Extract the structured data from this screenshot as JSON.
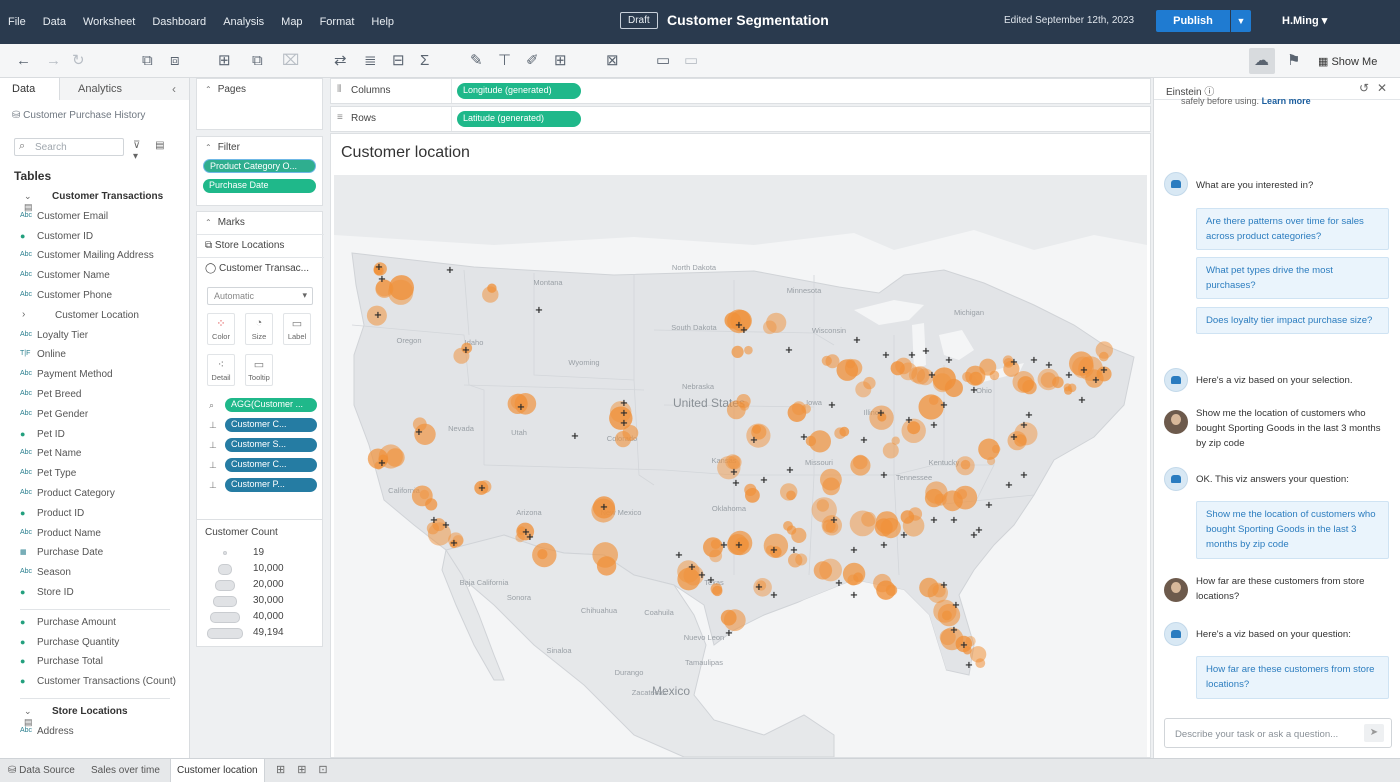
{
  "menu": [
    "File",
    "Data",
    "Worksheet",
    "Dashboard",
    "Analysis",
    "Map",
    "Format",
    "Help"
  ],
  "header": {
    "draft_label": "Draft",
    "workbook_title": "Customer Segmentation",
    "edited": "Edited September 12th, 2023",
    "publish_label": "Publish",
    "user": "H.Ming"
  },
  "toolbar": {
    "show_me": "Show Me"
  },
  "data_pane": {
    "tab_data": "Data",
    "tab_analytics": "Analytics",
    "source": "Customer Purchase History",
    "search_placeholder": "Search",
    "tables_heading": "Tables",
    "group1": "Customer Transactions",
    "fields1": [
      {
        "type": "Abc",
        "name": "Customer Email"
      },
      {
        "type": "●",
        "name": "Customer ID"
      },
      {
        "type": "Abc",
        "name": "Customer Mailing Address"
      },
      {
        "type": "Abc",
        "name": "Customer Name"
      },
      {
        "type": "Abc",
        "name": "Customer Phone"
      },
      {
        "type": "›",
        "name": "Customer Location"
      },
      {
        "type": "Abc",
        "name": "Loyalty Tier"
      },
      {
        "type": "T|F",
        "name": "Online"
      },
      {
        "type": "Abc",
        "name": "Payment Method"
      },
      {
        "type": "Abc",
        "name": "Pet Breed"
      },
      {
        "type": "Abc",
        "name": "Pet Gender"
      },
      {
        "type": "●",
        "name": "Pet ID"
      },
      {
        "type": "Abc",
        "name": "Pet Name"
      },
      {
        "type": "Abc",
        "name": "Pet Type"
      },
      {
        "type": "Abc",
        "name": "Product Category"
      },
      {
        "type": "●",
        "name": "Product ID"
      },
      {
        "type": "Abc",
        "name": "Product Name"
      },
      {
        "type": "▦",
        "name": "Purchase Date"
      },
      {
        "type": "Abc",
        "name": "Season"
      },
      {
        "type": "●",
        "name": "Store ID"
      }
    ],
    "measures1": [
      {
        "type": "●",
        "name": "Purchase Amount"
      },
      {
        "type": "●",
        "name": "Purchase Quantity"
      },
      {
        "type": "●",
        "name": "Purchase Total"
      },
      {
        "type": "●",
        "name": "Customer Transactions (Count)"
      }
    ],
    "group2": "Store Locations",
    "fields2": [
      {
        "type": "Abc",
        "name": "Address"
      }
    ]
  },
  "cards": {
    "pages": "Pages",
    "filter": "Filter",
    "filters": [
      "Product Category O...",
      "Purchase Date"
    ],
    "marks": "Marks",
    "marks_layers": [
      "Store Locations",
      "Customer Transac..."
    ],
    "mark_type": "Automatic",
    "mark_buttons": [
      "Color",
      "Size",
      "Label",
      "Detail",
      "Tooltip"
    ],
    "mark_pills": [
      {
        "label": "AGG(Customer ...",
        "color": "#1fb88a"
      },
      {
        "label": "Customer C...",
        "color": "#257ca3"
      },
      {
        "label": "Customer S...",
        "color": "#257ca3"
      },
      {
        "label": "Customer C...",
        "color": "#257ca3"
      },
      {
        "label": "Customer P...",
        "color": "#257ca3"
      }
    ],
    "legend_title": "Customer Count",
    "legend_values": [
      "19",
      "10,000",
      "20,000",
      "30,000",
      "40,000",
      "49,194"
    ]
  },
  "shelves": {
    "columns": "Columns",
    "rows": "Rows",
    "columns_pill": "Longitude (generated)",
    "rows_pill": "Latitude (generated)"
  },
  "viz": {
    "title": "Customer location",
    "map_labels": [
      "Montana",
      "North Dakota",
      "South Dakota",
      "Minnesota",
      "Wisconsin",
      "Michigan",
      "Oregon",
      "Idaho",
      "Wyoming",
      "Nebraska",
      "Iowa",
      "Illinois",
      "Ohio",
      "United States",
      "Nevada",
      "Utah",
      "Colorado",
      "Kansas",
      "Missouri",
      "Kentucky",
      "California",
      "Oklahoma",
      "Arizona",
      "New Mexico",
      "Texas",
      "Baja California",
      "Sonora",
      "Chihuahua",
      "Coahuila",
      "Nuevo Leon",
      "Durango",
      "Tamaulipas",
      "Sinaloa",
      "Mexico",
      "Zacatecas",
      "Tennessee"
    ],
    "accent_color": "#f0913a"
  },
  "einstein": {
    "title": "Einstein",
    "cut_text": "safely before using.",
    "cut_link": "Learn more",
    "messages": [
      {
        "who": "bot",
        "text": "What are you interested in?"
      },
      {
        "who": "bot",
        "text": "Here's a viz based on your selection."
      },
      {
        "who": "user",
        "text": "Show me the location of customers who bought Sporting Goods in the last 3 months by zip code"
      },
      {
        "who": "bot",
        "text": "OK. This viz answers your question:"
      },
      {
        "who": "user",
        "text": "How far are these customers from store locations?"
      },
      {
        "who": "bot",
        "text": "Here's a viz based on your question:"
      }
    ],
    "suggestions": [
      "Are there patterns over time for sales across product categories?",
      "What pet types drive the most purchases?",
      "Does loyalty tier impact purchase size?"
    ],
    "answer_card_1": "Show me the location of customers who bought Sporting Goods in the last 3 months by zip code",
    "answer_card_2": "How far are these customers from store locations?",
    "input_placeholder": "Describe your task or ask a question..."
  },
  "sheets": [
    "Data Source",
    "Sales over time",
    "Customer location"
  ]
}
